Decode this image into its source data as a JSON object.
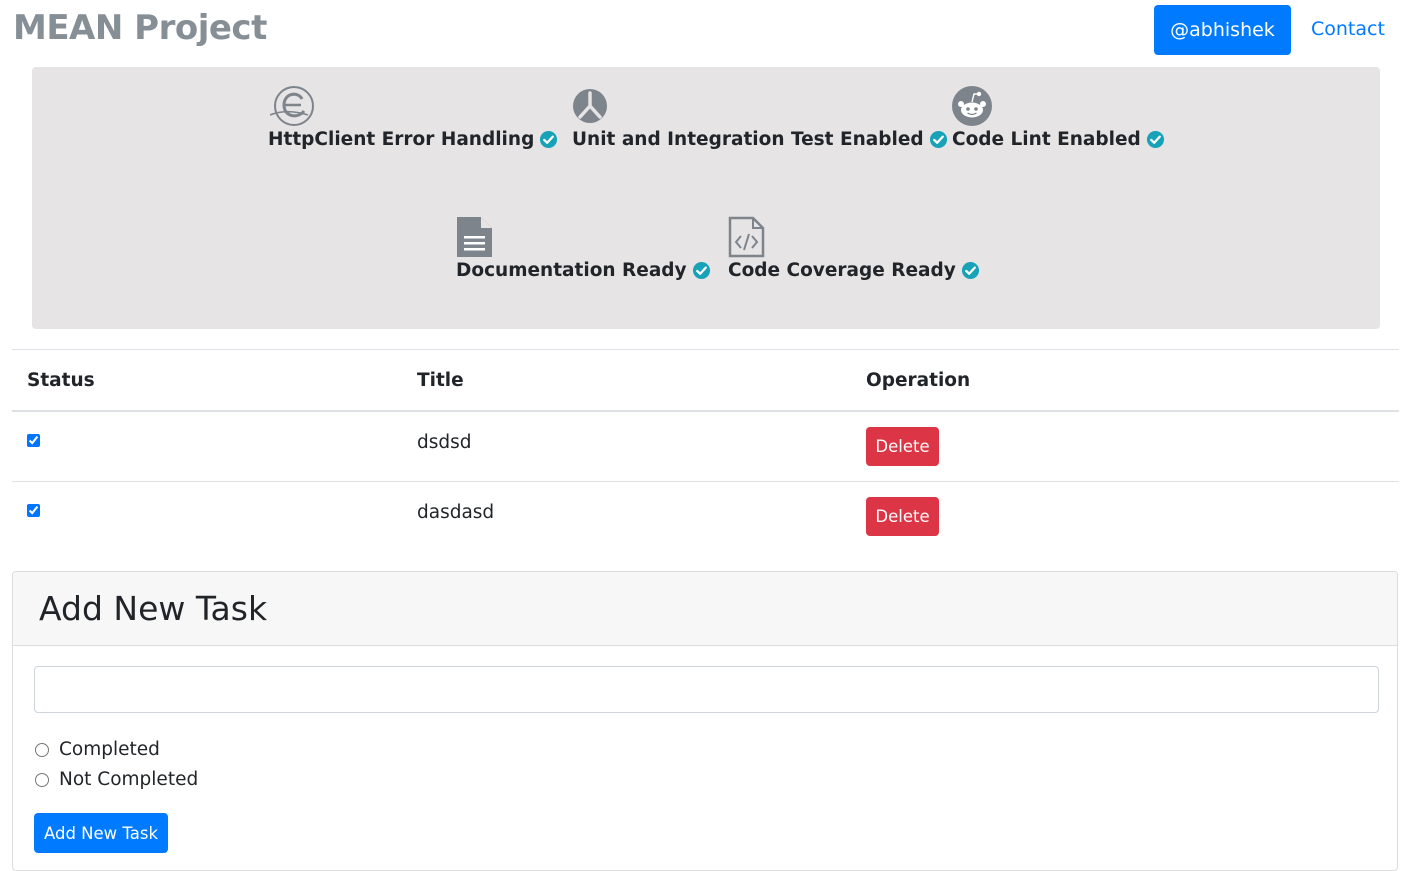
{
  "app": {
    "brand": "MEAN Project"
  },
  "nav": {
    "user_label": "@abhishek",
    "contact_label": "Contact"
  },
  "features": [
    {
      "label": "HttpClient Error Handling",
      "icon": "angular-e-icon"
    },
    {
      "label": "Unit and Integration Test Enabled",
      "icon": "karma-icon"
    },
    {
      "label": "Code Lint Enabled",
      "icon": "reddit-icon"
    },
    {
      "label": "Documentation Ready",
      "icon": "document-icon"
    },
    {
      "label": "Code Coverage Ready",
      "icon": "code-file-icon"
    }
  ],
  "table": {
    "headers": [
      "Status",
      "Title",
      "Operation"
    ],
    "rows": [
      {
        "completed": true,
        "title": "dsdsd",
        "action": "Delete"
      },
      {
        "completed": true,
        "title": "dasdasd",
        "action": "Delete"
      }
    ]
  },
  "form": {
    "header": "Add New Task",
    "title_value": "",
    "options": [
      "Completed",
      "Not Completed"
    ],
    "submit_label": "Add New Task"
  },
  "colors": {
    "primary": "#007bff",
    "danger": "#dc3545",
    "check_badge": "#17a2b8",
    "feature_bg": "#e6e4e5",
    "muted": "#868e96"
  }
}
